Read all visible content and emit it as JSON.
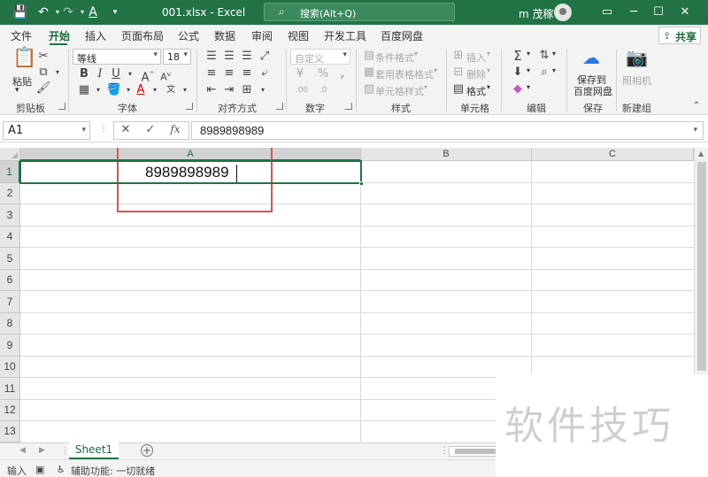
{
  "title_bar": {
    "doc_title": "001.xlsx  -  Excel",
    "search_placeholder": "搜索(Alt+Q)",
    "user_name": "m 茂稼"
  },
  "tabs": [
    "文件",
    "开始",
    "插入",
    "页面布局",
    "公式",
    "数据",
    "审阅",
    "视图",
    "开发工具",
    "百度网盘"
  ],
  "active_tab": "开始",
  "share_label": "共享",
  "ribbon": {
    "clipboard": {
      "paste": "粘贴",
      "label": "剪贴板"
    },
    "font": {
      "name": "等线",
      "size": "18",
      "label": "字体"
    },
    "alignment": {
      "label": "对齐方式"
    },
    "number": {
      "format": "自定义",
      "label": "数字"
    },
    "styles": {
      "conditional": "条件格式",
      "table": "套用表格格式",
      "cell_styles": "单元格样式",
      "label": "样式"
    },
    "cells": {
      "insert": "插入",
      "delete": "删除",
      "format": "格式",
      "label": "单元格"
    },
    "editing": {
      "label": "编辑"
    },
    "save": {
      "line1": "保存到",
      "line2": "百度网盘",
      "label": "保存"
    },
    "new_group": {
      "camera": "照相机",
      "label": "新建组"
    }
  },
  "formula_bar": {
    "name_box": "A1",
    "cancel": "✕",
    "enter": "✓",
    "fx": "fx",
    "value": "8989898989"
  },
  "grid": {
    "columns": [
      "A",
      "B",
      "C"
    ],
    "rows": [
      "1",
      "2",
      "3",
      "4",
      "5",
      "6",
      "7",
      "8",
      "9",
      "10",
      "11",
      "12",
      "13"
    ],
    "selected_cell": "A1",
    "a1_value": "8989898989"
  },
  "sheet_tabs": [
    "Sheet1"
  ],
  "status": {
    "mode": "输入",
    "accessibility": "辅助功能: 一切就绪"
  },
  "watermark": "软件技巧",
  "colors": {
    "accent": "#217346",
    "highlight_box": "#d9534f"
  }
}
